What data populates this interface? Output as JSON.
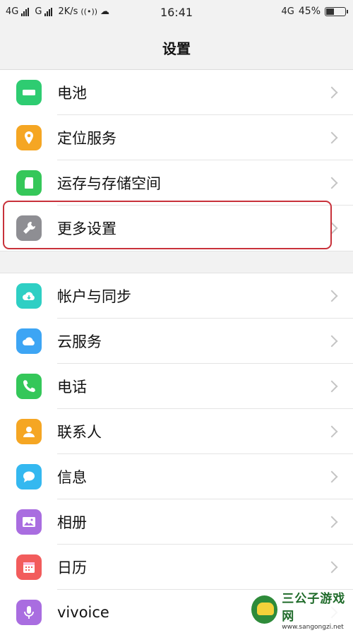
{
  "status_bar": {
    "carrier1": "4G",
    "carrier2": "G",
    "speed": "2K/s",
    "time": "16:41",
    "network": "4G",
    "battery_text": "45%",
    "battery_level": 0.45
  },
  "header": {
    "title": "设置"
  },
  "groups": [
    [
      {
        "label": "电池",
        "icon": "battery-icon",
        "color": "#2ecc71"
      },
      {
        "label": "定位服务",
        "icon": "location-pin-icon",
        "color": "#f5a623"
      },
      {
        "label": "运存与存储空间",
        "icon": "sd-card-icon",
        "color": "#35c759"
      },
      {
        "label": "更多设置",
        "icon": "wrench-icon",
        "color": "#8e8e93"
      }
    ],
    [
      {
        "label": "帐户与同步",
        "icon": "cloud-sync-icon",
        "color": "#2ecfc4"
      },
      {
        "label": "云服务",
        "icon": "cloud-icon",
        "color": "#3da5f4"
      },
      {
        "label": "电话",
        "icon": "phone-icon",
        "color": "#34c759"
      },
      {
        "label": "联系人",
        "icon": "contact-icon",
        "color": "#f5a623"
      },
      {
        "label": "信息",
        "icon": "message-icon",
        "color": "#34b8f0"
      },
      {
        "label": "相册",
        "icon": "photo-icon",
        "color": "#a96de0"
      },
      {
        "label": "日历",
        "icon": "calendar-icon",
        "color": "#f25c5c"
      },
      {
        "label": "vivoice",
        "icon": "microphone-icon",
        "color": "#a96de0"
      }
    ]
  ],
  "watermark": {
    "title": "三公子游戏网",
    "url": "www.sangongzi.net"
  }
}
